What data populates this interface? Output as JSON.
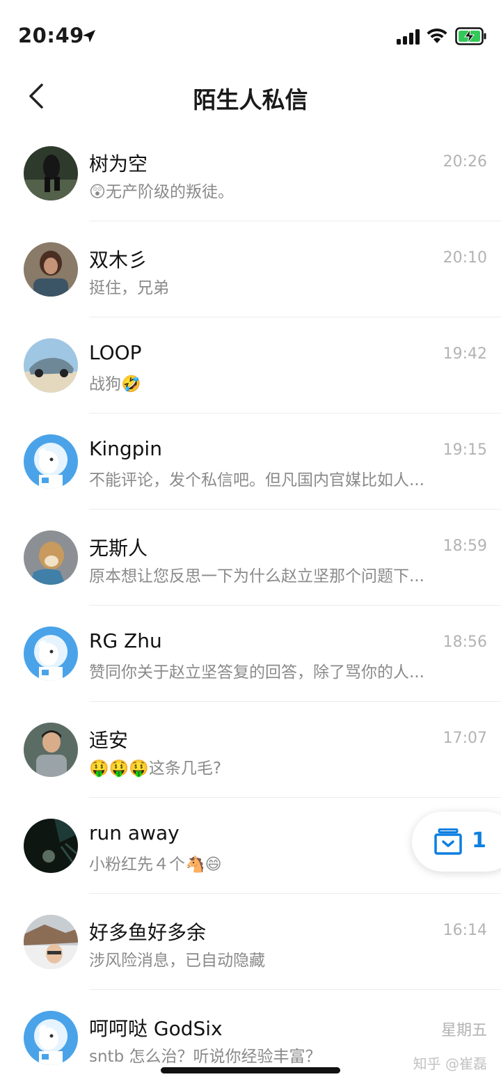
{
  "status_bar": {
    "time": "20:49"
  },
  "header": {
    "title": "陌生人私信"
  },
  "conversations": [
    {
      "name": "树为空",
      "time": "20:26",
      "preview": "😲无产阶级的叛徒。"
    },
    {
      "name": "双木彡",
      "time": "20:10",
      "preview": "挺住，兄弟"
    },
    {
      "name": "LOOP",
      "time": "19:42",
      "preview": "战狗🤣"
    },
    {
      "name": "Kingpin",
      "time": "19:15",
      "preview": "不能评论，发个私信吧。但凡国内官媒比如人..."
    },
    {
      "name": "无斯人",
      "time": "18:59",
      "preview": "原本想让您反思一下为什么赵立坚那个问题下..."
    },
    {
      "name": "RG Zhu",
      "time": "18:56",
      "preview": "赞同你关于赵立坚答复的回答，除了骂你的人..."
    },
    {
      "name": "适安",
      "time": "17:07",
      "preview": "🤑🤑🤑这条几毛?"
    },
    {
      "name": "run away",
      "time": "",
      "preview": "小粉红先４个🐴😄"
    },
    {
      "name": "好多鱼好多余",
      "time": "16:14",
      "preview": "涉风险消息，已自动隐藏"
    },
    {
      "name": "呵呵哒 GodSix",
      "time": "星期五",
      "preview": "sntb 怎么治？听说你经验丰富？"
    }
  ],
  "float_button": {
    "count": "1"
  },
  "watermark": "知乎 @崔磊",
  "colors": {
    "accent": "#0d7fe0",
    "time_gray": "#b3b3b3",
    "preview_gray": "#8a8a8a"
  }
}
